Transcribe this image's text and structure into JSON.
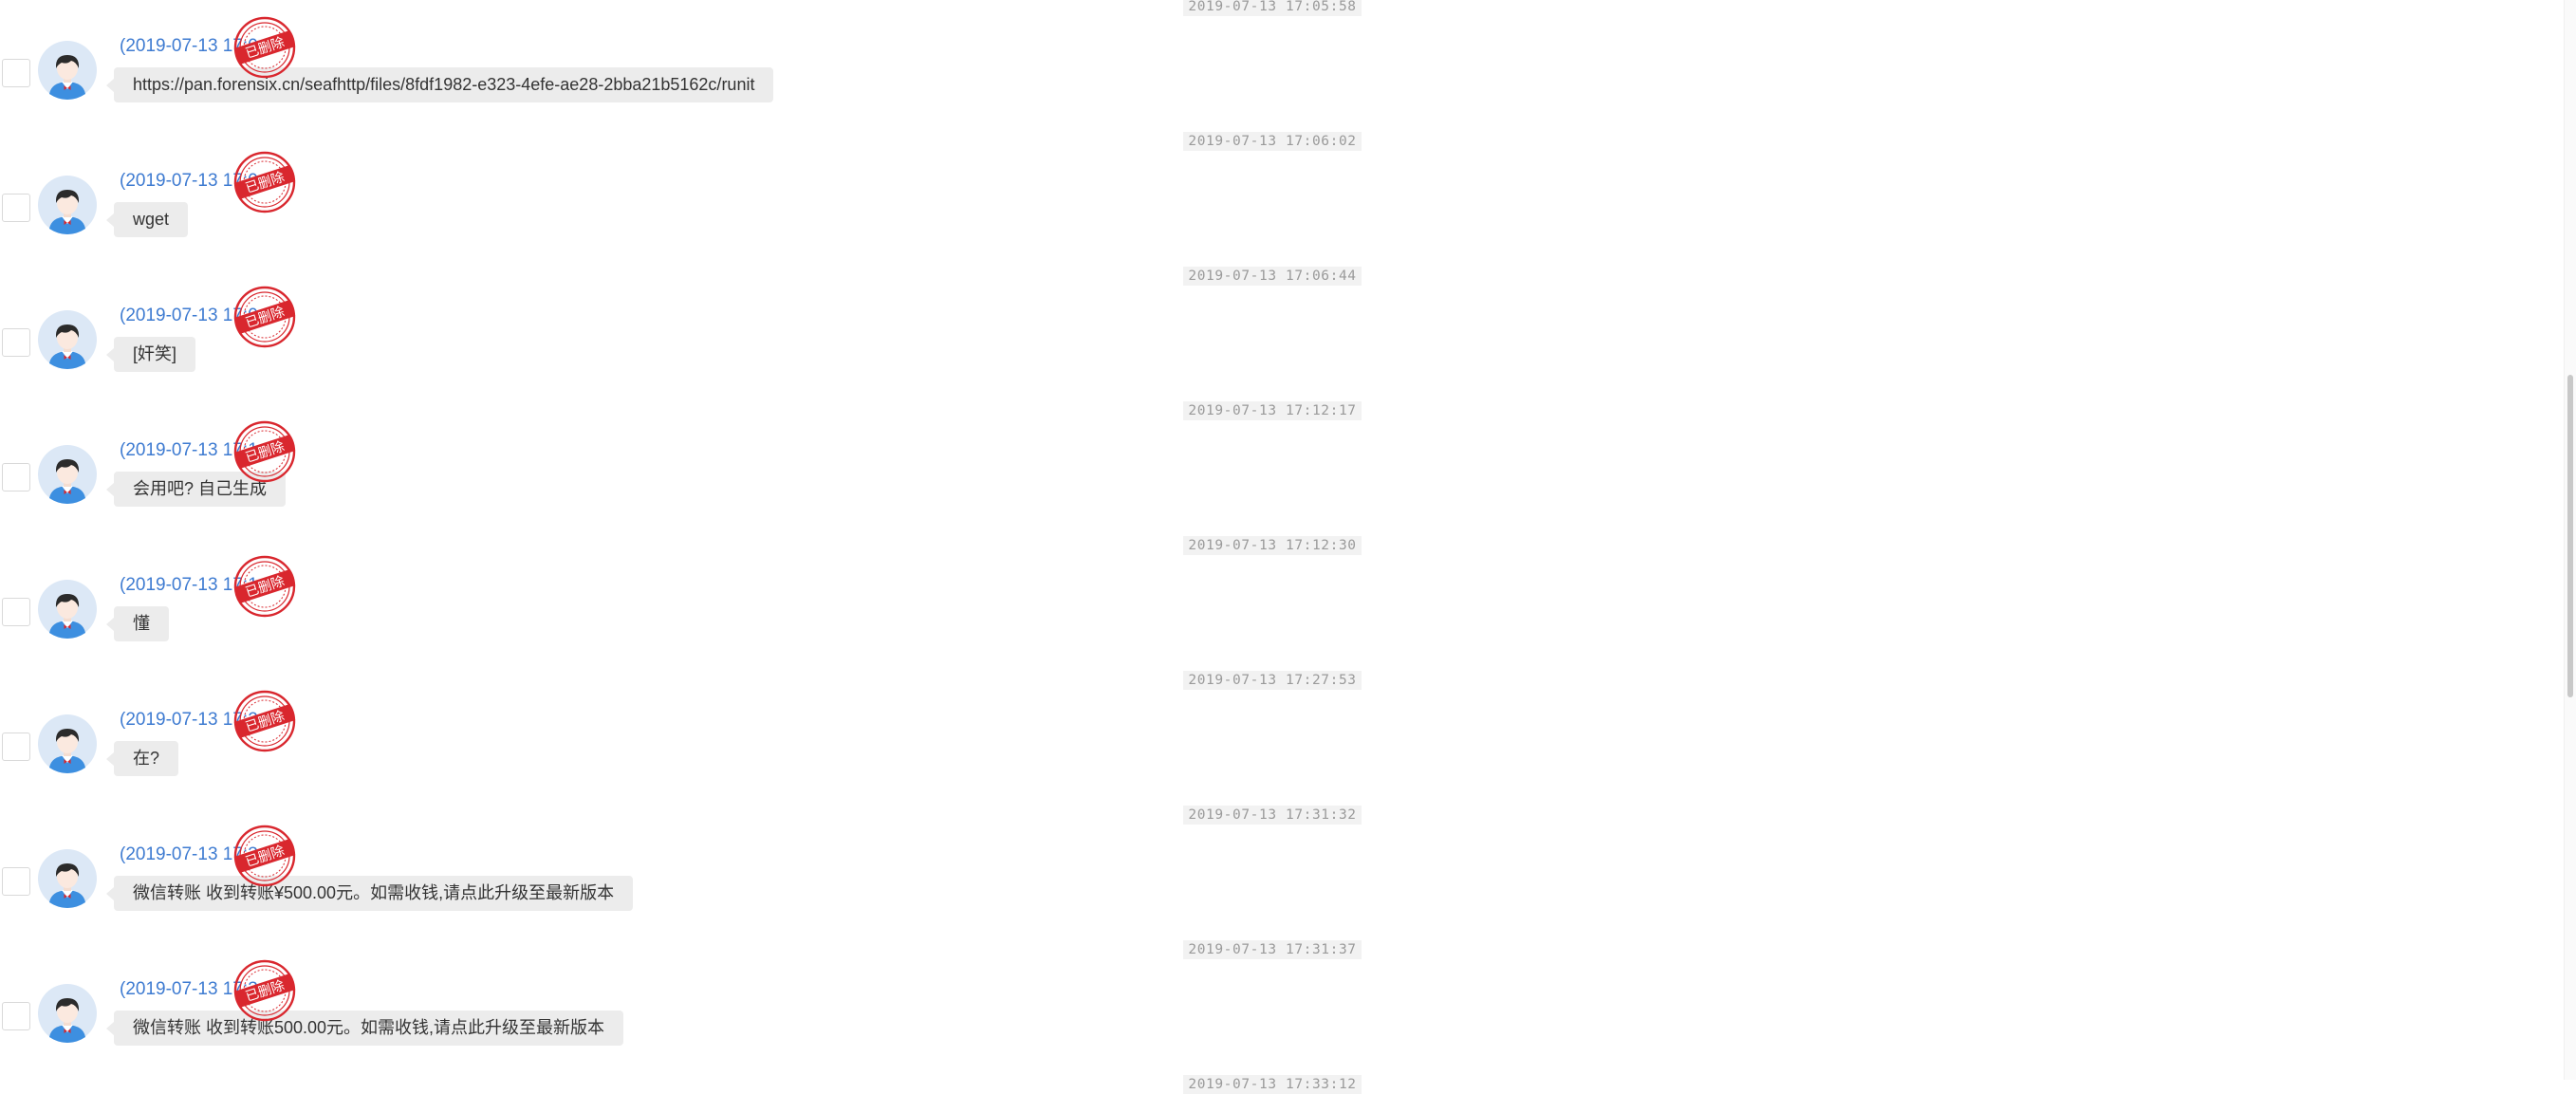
{
  "stamp_label": "已删除",
  "icons": {
    "avatar": "user-avatar-icon",
    "stamp": "deleted-stamp-icon",
    "checkbox": "checkbox-icon"
  },
  "colors": {
    "sender_name": "#3e7bd1",
    "stamp_red": "#d9272e",
    "bubble_bg": "#ececec",
    "timestamp_bg": "#f2f2f2"
  },
  "messages": [
    {
      "timestamp": "2019-07-13 17:05:58",
      "sender": "(2019-07-13 17:0",
      "text": "https://pan.forensix.cn/seafhttp/files/8fdf1982-e323-4efe-ae28-2bba21b5162c/runit"
    },
    {
      "timestamp": "2019-07-13 17:06:02",
      "sender": "(2019-07-13 17:0",
      "text": "wget"
    },
    {
      "timestamp": "2019-07-13 17:06:44",
      "sender": "(2019-07-13 17:0",
      "text": "[奸笑]"
    },
    {
      "timestamp": "2019-07-13 17:12:17",
      "sender": "(2019-07-13 17:1",
      "text": "会用吧? 自己生成"
    },
    {
      "timestamp": "2019-07-13 17:12:30",
      "sender": "(2019-07-13 17:1",
      "text": "懂"
    },
    {
      "timestamp": "2019-07-13 17:27:53",
      "sender": "(2019-07-13 17:2",
      "text": "在?"
    },
    {
      "timestamp": "2019-07-13 17:31:32",
      "sender": "(2019-07-13 17:3",
      "text": "微信转账 收到转账¥500.00元。如需收钱,请点此升级至最新版本"
    },
    {
      "timestamp": "2019-07-13 17:31:37",
      "sender": "(2019-07-13 17:3",
      "text": "微信转账 收到转账500.00元。如需收钱,请点此升级至最新版本"
    }
  ],
  "partial_timestamp": "2019-07-13 17:33:12"
}
